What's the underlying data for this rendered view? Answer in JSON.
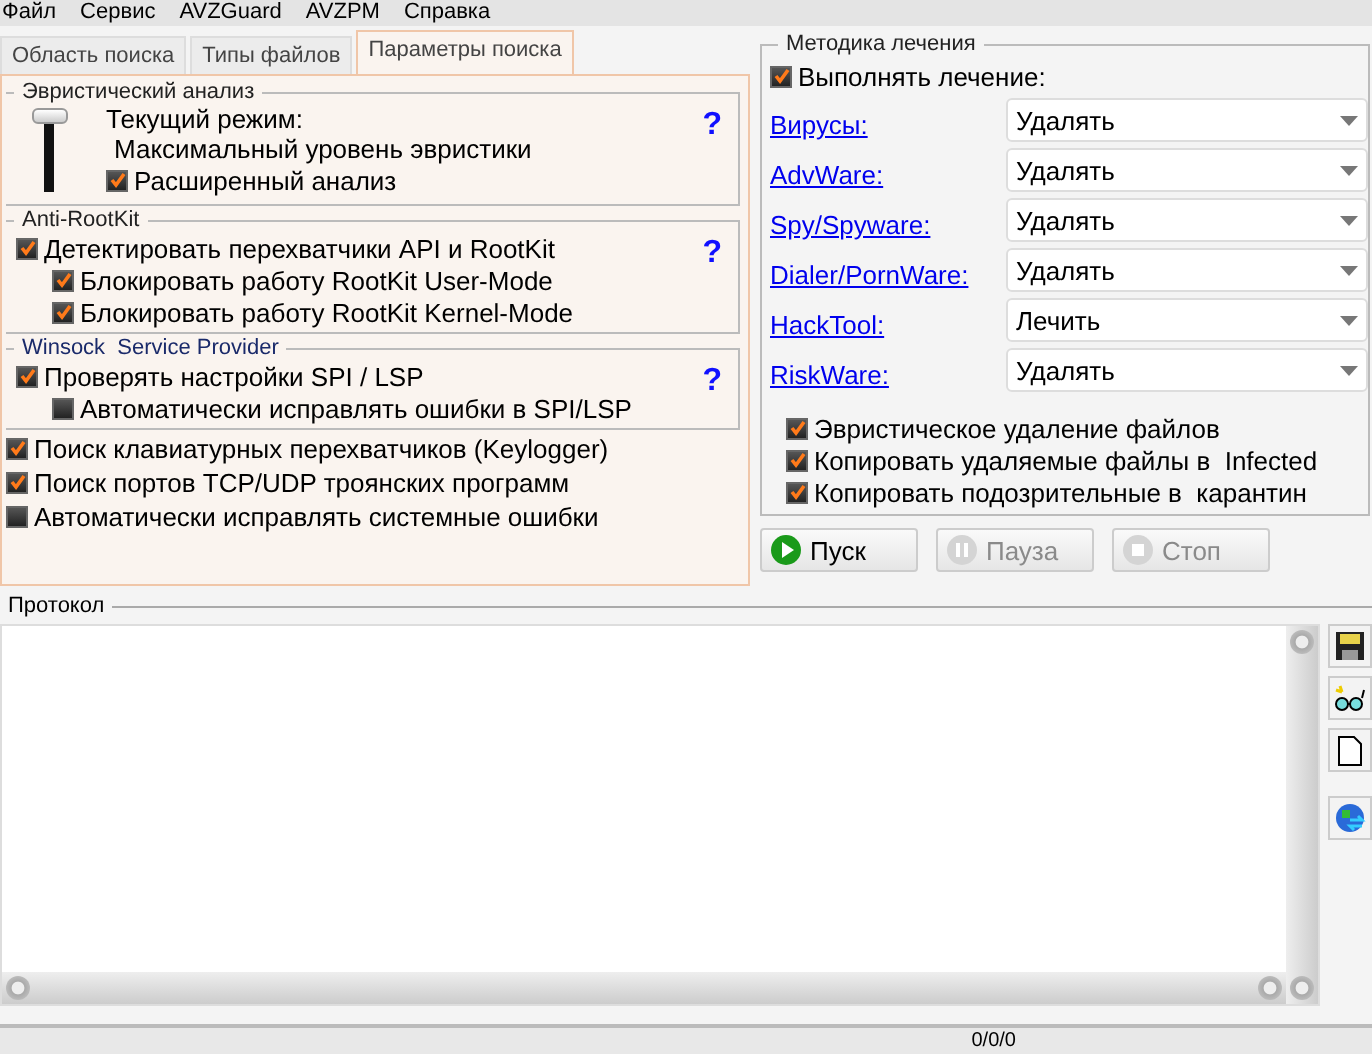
{
  "menu": [
    "Файл",
    "Сервис",
    "AVZGuard",
    "AVZPM",
    "Справка"
  ],
  "tabs": [
    {
      "label": "Область поиска",
      "selected": false
    },
    {
      "label": "Типы файлов",
      "selected": false
    },
    {
      "label": "Параметры поиска",
      "selected": true
    }
  ],
  "heuristic": {
    "title": "Эвристический анализ",
    "level": 1,
    "mode_label": "Текущий режим:",
    "mode_value": "Максимальный уровень эвристики",
    "help": "?",
    "extended": {
      "label": "Расширенный анализ",
      "checked": true
    }
  },
  "antirootkit": {
    "title": "Anti-RootKit",
    "help": "?",
    "items": [
      {
        "label": "Детектировать перехватчики API и RootKit",
        "checked": true,
        "children": [
          {
            "label": "Блокировать работу RootKit User-Mode",
            "checked": true
          },
          {
            "label": "Блокировать работу RootKit Kernel-Mode",
            "checked": true
          }
        ]
      }
    ]
  },
  "winsock": {
    "title": "Winsock  Service Provider",
    "help": "?",
    "items": [
      {
        "label": "Проверять настройки SPI / LSP",
        "checked": true,
        "children": [
          {
            "label": "Автоматически исправлять ошибки в SPI/LSP",
            "checked": false
          }
        ]
      }
    ]
  },
  "options": [
    {
      "label": "Поиск клавиатурных перехватчиков (Keylogger)",
      "checked": true
    },
    {
      "label": "Поиск портов TCP/UDP троянских программ",
      "checked": true
    },
    {
      "label": "Автоматически исправлять системные ошибки",
      "checked": false
    }
  ],
  "treatment": {
    "title": "Методика лечения",
    "enable": {
      "label": "Выполнять лечение:",
      "checked": true
    },
    "rows": [
      {
        "link": "Вирусы:",
        "value": "Удалять"
      },
      {
        "link": "AdvWare:",
        "value": "Удалять"
      },
      {
        "link": "Spy/Spyware:",
        "value": "Удалять"
      },
      {
        "link": "Dialer/PornWare:",
        "value": "Удалять"
      },
      {
        "link": "HackTool:",
        "value": "Лечить"
      },
      {
        "link": "RiskWare:",
        "value": "Удалять"
      }
    ],
    "options": [
      {
        "label": "Эвристическое удаление файлов",
        "checked": true
      },
      {
        "label": "Копировать удаляемые файлы в  Infected",
        "checked": true
      },
      {
        "label": "Копировать подозрительные в  карантин",
        "checked": true
      }
    ]
  },
  "buttons": [
    {
      "label": "Пуск",
      "kind": "play",
      "disabled": false
    },
    {
      "label": "Пауза",
      "kind": "pause",
      "disabled": true
    },
    {
      "label": "Стоп",
      "kind": "stop",
      "disabled": true
    }
  ],
  "protocol": {
    "title": "Протокол"
  },
  "status_bar": {
    "counter": "0/0/0"
  }
}
